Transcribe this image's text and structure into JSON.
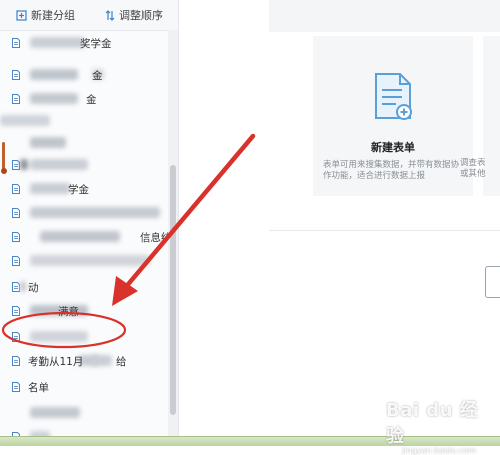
{
  "sidebar": {
    "new_group": "新建分组",
    "reorder": "调整顺序",
    "items": [
      {
        "text": "奖学金"
      },
      {
        "text": "金"
      },
      {
        "text": "金"
      },
      {
        "text": ""
      },
      {
        "text": ""
      },
      {
        "text": ""
      },
      {
        "text": "学金"
      },
      {
        "text": ""
      },
      {
        "text": "信息统..."
      },
      {
        "text": ""
      },
      {
        "text": "动"
      },
      {
        "text": "满意"
      },
      {
        "text": ""
      },
      {
        "text": "考勤从11月"
      },
      {
        "text": "名单"
      },
      {
        "text": ""
      },
      {
        "text": ""
      },
      {
        "text": "名表单"
      }
    ],
    "highlighted_suffix": "给"
  },
  "main": {
    "new_form_card": {
      "title": "新建表单",
      "description": "表单可用来搜集数据，并带有数据协作功能，适合进行数据上报"
    },
    "second_card": {
      "description_line1": "调查表",
      "description_line2": "或其他"
    }
  },
  "watermark": {
    "main": "Bai du 经验",
    "sub": "jingyan.baidu.com"
  },
  "colors": {
    "annotation_red": "#d9322b",
    "accent_blue": "#2d7fcf"
  }
}
